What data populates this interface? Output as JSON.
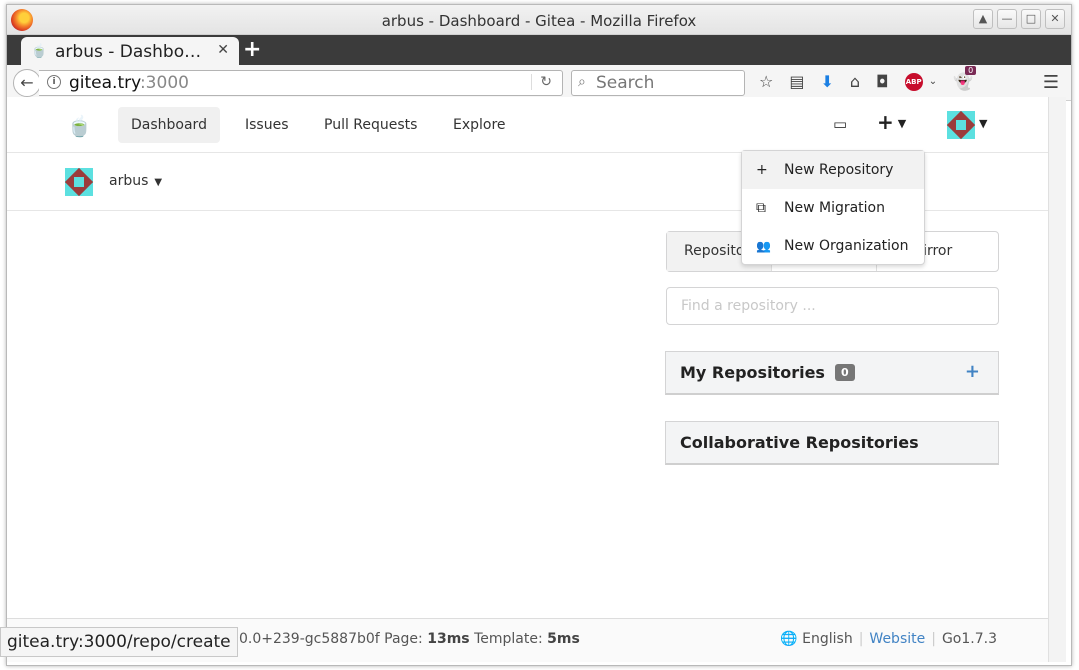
{
  "window": {
    "title": "arbus - Dashboard - Gitea - Mozilla Firefox",
    "controls": [
      "▲",
      "—",
      "□",
      "✕"
    ]
  },
  "tab": {
    "title": "arbus - Dashbo…",
    "close": "✕",
    "new_tab": "+"
  },
  "navbar": {
    "url_host": "gitea.try",
    "url_port": ":3000",
    "search_placeholder": "Search",
    "addon_badge": "0",
    "abp_label": "ABP"
  },
  "header": {
    "nav": [
      "Dashboard",
      "Issues",
      "Pull Requests",
      "Explore"
    ],
    "active_nav": "Dashboard",
    "plus": "+"
  },
  "dropdown": {
    "items": [
      {
        "icon": "+",
        "label": "New Repository"
      },
      {
        "icon": "⧉",
        "label": "New Migration"
      },
      {
        "icon": "👥",
        "label": "New Organization"
      }
    ]
  },
  "context": {
    "user": "arbus"
  },
  "repos": {
    "tabs": [
      "Repositories",
      "",
      "Mirror"
    ],
    "find_placeholder": "Find a repository ...",
    "my_title": "My Repositories",
    "my_count": "0",
    "collab_title": "Collaborative Repositories"
  },
  "footer": {
    "version_tail": "0.0+239-gc5887b0f Page:",
    "page_time": "13ms",
    "template_label": "Template:",
    "template_time": "5ms",
    "language": "English",
    "website": "Website",
    "go_version": "Go1.7.3"
  },
  "statusbar": {
    "link": "gitea.try:3000/repo/create"
  },
  "colors": {
    "accent": "#4183c4",
    "badge": "#767676",
    "tabbar": "#3b3b3b"
  }
}
